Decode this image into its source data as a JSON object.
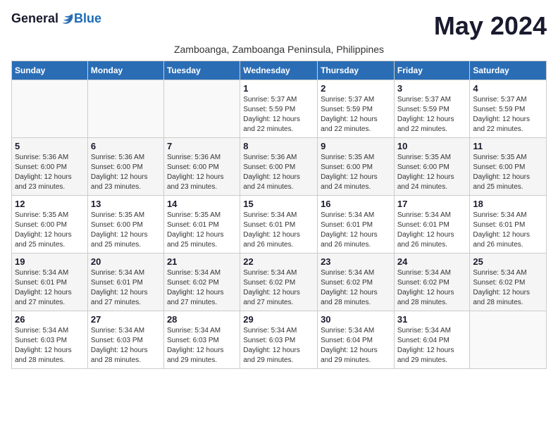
{
  "header": {
    "logo_general": "General",
    "logo_blue": "Blue",
    "month_title": "May 2024",
    "location": "Zamboanga, Zamboanga Peninsula, Philippines"
  },
  "weekdays": [
    "Sunday",
    "Monday",
    "Tuesday",
    "Wednesday",
    "Thursday",
    "Friday",
    "Saturday"
  ],
  "weeks": [
    [
      {
        "day": "",
        "info": ""
      },
      {
        "day": "",
        "info": ""
      },
      {
        "day": "",
        "info": ""
      },
      {
        "day": "1",
        "info": "Sunrise: 5:37 AM\nSunset: 5:59 PM\nDaylight: 12 hours\nand 22 minutes."
      },
      {
        "day": "2",
        "info": "Sunrise: 5:37 AM\nSunset: 5:59 PM\nDaylight: 12 hours\nand 22 minutes."
      },
      {
        "day": "3",
        "info": "Sunrise: 5:37 AM\nSunset: 5:59 PM\nDaylight: 12 hours\nand 22 minutes."
      },
      {
        "day": "4",
        "info": "Sunrise: 5:37 AM\nSunset: 5:59 PM\nDaylight: 12 hours\nand 22 minutes."
      }
    ],
    [
      {
        "day": "5",
        "info": "Sunrise: 5:36 AM\nSunset: 6:00 PM\nDaylight: 12 hours\nand 23 minutes."
      },
      {
        "day": "6",
        "info": "Sunrise: 5:36 AM\nSunset: 6:00 PM\nDaylight: 12 hours\nand 23 minutes."
      },
      {
        "day": "7",
        "info": "Sunrise: 5:36 AM\nSunset: 6:00 PM\nDaylight: 12 hours\nand 23 minutes."
      },
      {
        "day": "8",
        "info": "Sunrise: 5:36 AM\nSunset: 6:00 PM\nDaylight: 12 hours\nand 24 minutes."
      },
      {
        "day": "9",
        "info": "Sunrise: 5:35 AM\nSunset: 6:00 PM\nDaylight: 12 hours\nand 24 minutes."
      },
      {
        "day": "10",
        "info": "Sunrise: 5:35 AM\nSunset: 6:00 PM\nDaylight: 12 hours\nand 24 minutes."
      },
      {
        "day": "11",
        "info": "Sunrise: 5:35 AM\nSunset: 6:00 PM\nDaylight: 12 hours\nand 25 minutes."
      }
    ],
    [
      {
        "day": "12",
        "info": "Sunrise: 5:35 AM\nSunset: 6:00 PM\nDaylight: 12 hours\nand 25 minutes."
      },
      {
        "day": "13",
        "info": "Sunrise: 5:35 AM\nSunset: 6:00 PM\nDaylight: 12 hours\nand 25 minutes."
      },
      {
        "day": "14",
        "info": "Sunrise: 5:35 AM\nSunset: 6:01 PM\nDaylight: 12 hours\nand 25 minutes."
      },
      {
        "day": "15",
        "info": "Sunrise: 5:34 AM\nSunset: 6:01 PM\nDaylight: 12 hours\nand 26 minutes."
      },
      {
        "day": "16",
        "info": "Sunrise: 5:34 AM\nSunset: 6:01 PM\nDaylight: 12 hours\nand 26 minutes."
      },
      {
        "day": "17",
        "info": "Sunrise: 5:34 AM\nSunset: 6:01 PM\nDaylight: 12 hours\nand 26 minutes."
      },
      {
        "day": "18",
        "info": "Sunrise: 5:34 AM\nSunset: 6:01 PM\nDaylight: 12 hours\nand 26 minutes."
      }
    ],
    [
      {
        "day": "19",
        "info": "Sunrise: 5:34 AM\nSunset: 6:01 PM\nDaylight: 12 hours\nand 27 minutes."
      },
      {
        "day": "20",
        "info": "Sunrise: 5:34 AM\nSunset: 6:01 PM\nDaylight: 12 hours\nand 27 minutes."
      },
      {
        "day": "21",
        "info": "Sunrise: 5:34 AM\nSunset: 6:02 PM\nDaylight: 12 hours\nand 27 minutes."
      },
      {
        "day": "22",
        "info": "Sunrise: 5:34 AM\nSunset: 6:02 PM\nDaylight: 12 hours\nand 27 minutes."
      },
      {
        "day": "23",
        "info": "Sunrise: 5:34 AM\nSunset: 6:02 PM\nDaylight: 12 hours\nand 28 minutes."
      },
      {
        "day": "24",
        "info": "Sunrise: 5:34 AM\nSunset: 6:02 PM\nDaylight: 12 hours\nand 28 minutes."
      },
      {
        "day": "25",
        "info": "Sunrise: 5:34 AM\nSunset: 6:02 PM\nDaylight: 12 hours\nand 28 minutes."
      }
    ],
    [
      {
        "day": "26",
        "info": "Sunrise: 5:34 AM\nSunset: 6:03 PM\nDaylight: 12 hours\nand 28 minutes."
      },
      {
        "day": "27",
        "info": "Sunrise: 5:34 AM\nSunset: 6:03 PM\nDaylight: 12 hours\nand 28 minutes."
      },
      {
        "day": "28",
        "info": "Sunrise: 5:34 AM\nSunset: 6:03 PM\nDaylight: 12 hours\nand 29 minutes."
      },
      {
        "day": "29",
        "info": "Sunrise: 5:34 AM\nSunset: 6:03 PM\nDaylight: 12 hours\nand 29 minutes."
      },
      {
        "day": "30",
        "info": "Sunrise: 5:34 AM\nSunset: 6:04 PM\nDaylight: 12 hours\nand 29 minutes."
      },
      {
        "day": "31",
        "info": "Sunrise: 5:34 AM\nSunset: 6:04 PM\nDaylight: 12 hours\nand 29 minutes."
      },
      {
        "day": "",
        "info": ""
      }
    ]
  ]
}
